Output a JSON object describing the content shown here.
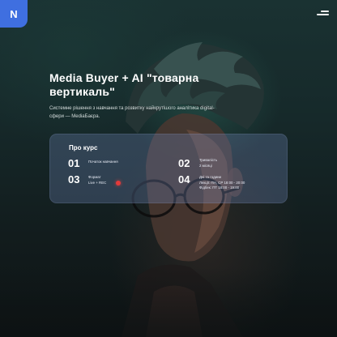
{
  "header": {
    "logo_letter": "N",
    "menu_icon": "hamburger-menu-icon"
  },
  "hero": {
    "title_line1": "Media Buyer + AI \"товарна",
    "title_line2": "вертикаль\"",
    "description_line1": "Системне рішення з навчання та розвитку найкрутішого аналітика digital-",
    "description_line2": "сфери — MediaБаєра."
  },
  "course": {
    "heading": "Про курс",
    "items": [
      {
        "number": "01",
        "label_line1": "Початок навчання",
        "label_line2": ""
      },
      {
        "number": "02",
        "label_line1": "Тривалість",
        "label_line2": "2 місяці"
      },
      {
        "number": "03",
        "label_line1": "Формат",
        "label_line2": "Live + REC"
      },
      {
        "number": "04",
        "label_line1": "Дні та години",
        "label_line2": "Лекції: ПН, СР 18:00 - 20:00",
        "label_line3": "Фідбек: ПТ 18:00 - 19:00"
      }
    ],
    "live_indicator_color": "#e33a3a"
  },
  "colors": {
    "accent": "#3f6fe0",
    "background": "#16292a"
  }
}
